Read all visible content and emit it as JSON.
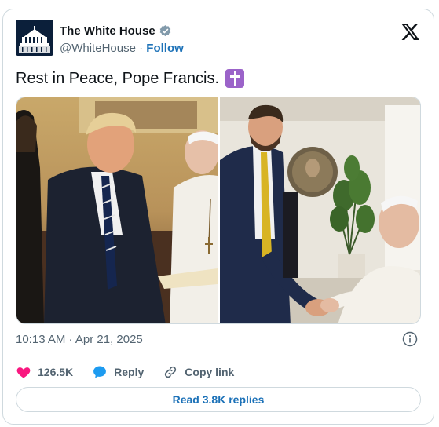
{
  "account": {
    "display_name": "The White House",
    "handle": "@WhiteHouse",
    "separator": "·",
    "follow_label": "Follow"
  },
  "tweet": {
    "text": "Rest in Peace, Pope Francis.",
    "emoji": "latin-cross-emoji",
    "timestamp": "10:13 AM · Apr 21, 2025"
  },
  "media": {
    "photos": [
      "photo-meeting-left",
      "photo-handshake-right"
    ]
  },
  "actions": {
    "likes": "126.5K",
    "reply_label": "Reply",
    "copy_link_label": "Copy link"
  },
  "replies": {
    "read_label": "Read 3.8K replies"
  },
  "colors": {
    "accent": "#1d72b8",
    "like_heart": "#f91880",
    "reply_bubble": "#1d9bf0",
    "verified_badge": "#829aab",
    "emoji_bg": "#9b63c9"
  }
}
